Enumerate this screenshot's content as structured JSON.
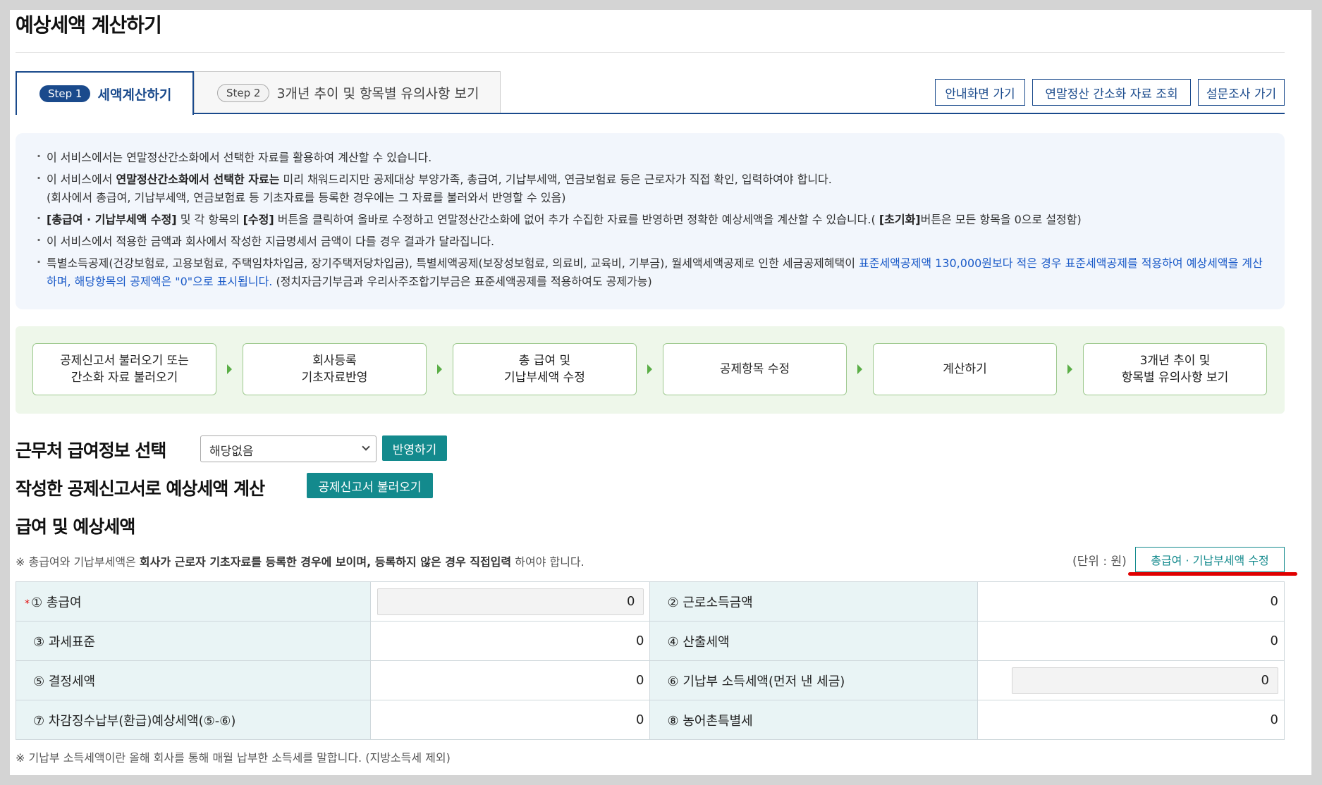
{
  "page_title": "예상세액 계산하기",
  "tabs": [
    {
      "step": "Step 1",
      "label": "세액계산하기"
    },
    {
      "step": "Step 2",
      "label": "3개년 추이 및 항목별 유의사항 보기"
    }
  ],
  "top_buttons": {
    "guide": "안내화면 가기",
    "simplified": "연말정산 간소화 자료 조회",
    "survey": "설문조사 가기"
  },
  "info": {
    "l1": "이 서비스에서는 연말정산간소화에서 선택한 자료를 활용하여 계산할 수 있습니다.",
    "l2a": "이 서비스에서 ",
    "l2b": "연말정산간소화에서 선택한 자료는",
    "l2c": " 미리 채워드리지만 공제대상 부양가족, 총급여, 기납부세액, 연금보험료 등은 근로자가 직접 확인, 입력하여야 합니다.",
    "l2d": "(회사에서 총급여, 기납부세액, 연금보험료 등 기초자료를 등록한 경우에는 그 자료를 불러와서 반영할 수 있음)",
    "l3a": "[총급여 · 기납부세액 수정]",
    "l3b": "  및 각 항목의 ",
    "l3c": "[수정]",
    "l3d": " 버튼을 클릭하여 올바로 수정하고 연말정산간소화에 없어 추가 수집한 자료를 반영하면 정확한 예상세액을 계산할 수 있습니다.( ",
    "l3e": "[초기화]",
    "l3f": "버튼은 모든 항목을 0으로 설정함)",
    "l4": "이 서비스에서 적용한 금액과 회사에서 작성한 지급명세서 금액이 다를 경우 결과가 달라집니다.",
    "l5a": "특별소득공제(건강보험료, 고용보험료, 주택임차차입금, 장기주택저당차입금), 특별세액공제(보장성보험료, 의료비, 교육비, 기부금), 월세액세액공제로 인한 세금공제혜택이 ",
    "l5b": "표준세액공제액 130,000원보다 적은 경우 표준세액공제를 적용하여 예상세액을 계산하며, 해당항목의 공제액은 \"0\"으로 표시됩니다.",
    "l5c": " (정치자금기부금과 우리사주조합기부금은 표준세액공제를 적용하여도 공제가능)"
  },
  "flow": [
    {
      "line1": "공제신고서 불러오기 또는",
      "line2": "간소화 자료 불러오기"
    },
    {
      "line1": "회사등록",
      "line2": "기초자료반영"
    },
    {
      "line1": "총 급여 및",
      "line2": "기납부세액 수정"
    },
    {
      "line1": "공제항목 수정",
      "line2": ""
    },
    {
      "line1": "계산하기",
      "line2": ""
    },
    {
      "line1": "3개년 추이 및",
      "line2": "항목별 유의사항 보기"
    }
  ],
  "workplace": {
    "title": "근무처 급여정보 선택",
    "selected": "해당없음",
    "apply_label": "반영하기"
  },
  "declaration": {
    "title": "작성한 공제신고서로 예상세액 계산",
    "load_label": "공제신고서 불러오기"
  },
  "salary": {
    "title": "급여 및 예상세액",
    "note_a": "※ 총급여와 기납부세액은 ",
    "note_b": "회사가 근로자 기초자료를 등록한 경우에 보이며, 등록하지 않은 경우 직접입력",
    "note_c": " 하여야 합니다.",
    "unit": "(단위 : 원)",
    "edit_label": "총급여 · 기납부세액 수정",
    "required_mark": "*",
    "rows": [
      {
        "l1": "① 총급여",
        "v1": "0",
        "l2": "② 근로소득금액",
        "v2": "0"
      },
      {
        "l1": "③ 과세표준",
        "v1": "0",
        "l2": "④ 산출세액",
        "v2": "0"
      },
      {
        "l1": "⑤ 결정세액",
        "v1": "0",
        "l2": "⑥ 기납부 소득세액(먼저 낸 세금)",
        "v2": "0"
      },
      {
        "l1": "⑦ 차감징수납부(환급)예상세액(⑤-⑥)",
        "v1": "0",
        "l2": "⑧ 농어촌특별세",
        "v2": "0"
      }
    ],
    "footnote": "※ 기납부 소득세액이란 올해 회사를 통해 매월 납부한 소득세를 말합니다. (지방소득세 제외)"
  }
}
